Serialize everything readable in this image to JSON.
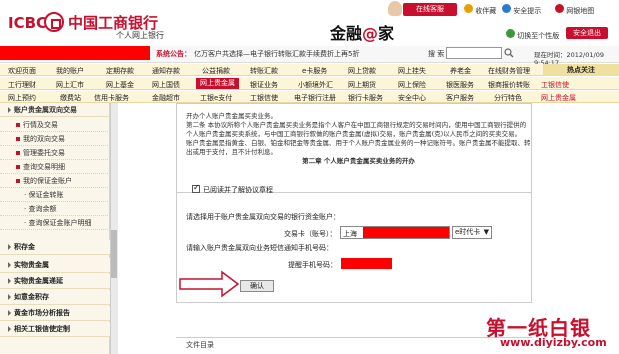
{
  "header": {
    "brand": "ICBC",
    "bank_name": "中国工商银行",
    "subtitle": "个人网上银行",
    "jinrong_a": "金融",
    "jinrong_at": "@",
    "jinrong_b": "家",
    "online_service": "在线客服",
    "favorites": "收伴藏",
    "security_notice": "安全提示",
    "site_nav": "网银地图",
    "switch_version": "切换至个性版",
    "safe_exit": "安全退出"
  },
  "notice": {
    "label": "系统公告：",
    "text": "亿万客户共选择—电子银行转账汇款手续费折上再5折",
    "search_label": "搜 索",
    "time": "现在时间：2012/01/09  9:54:17"
  },
  "nav": {
    "row1": [
      "欢迎页面",
      "我的账户",
      "定期存款",
      "通知存款",
      "公益捐款",
      "转账汇款",
      "e卡服务",
      "网上贷款",
      "网上挂失",
      "养老金",
      "在线财务管理"
    ],
    "row2": [
      "工行理财",
      "网上汇市",
      "网上基金",
      "网上国债",
      "网上贵金属",
      "银证业务",
      "小额境外汇",
      "网上期货",
      "网上保险",
      "银医服务",
      "银商报价转账"
    ],
    "row3": [
      "网上预约",
      "缴费站",
      "信用卡服务",
      "金融超市",
      "工银e支付",
      "工银信使",
      "电子银行注册",
      "银行卡服务",
      "安全中心",
      "客户服务",
      "分行特色"
    ],
    "active": "网上贵金属",
    "hot_title": "热点关注",
    "hot_items": [
      "工银信使",
      "网上贵金属"
    ]
  },
  "sidebar": {
    "head": "账户贵金属双向交易",
    "items": [
      "行情及交易",
      "我的双向交易",
      "管理委托交易",
      "查询交易明细",
      "我的保证金账户"
    ],
    "subitems": [
      "保证金转账",
      "查询余额",
      "查询保证金账户明细"
    ],
    "groups": [
      "积存金",
      "实物贵金属",
      "实物贵金属递延",
      "如意金积存",
      "黄金市场分析报告",
      "相关工银信使定制"
    ]
  },
  "main": {
    "agreement_line1": "开办个人账户贵金属买卖业务。",
    "agreement_line2": "第二条    本协议所称个人账户贵金属买卖业务是指个人客户在中国工商银行规定的交易时间内，使用中国工商银行提供的个人账户贵金属买卖系统，与中国工商银行叙做的账户贵金属(虚拟)交易，账户贵金属(克)以人民币之间的买卖交易。",
    "agreement_line3": "账户贵金属是指黄金、白银、铂金和钯金等贵金属、用于个人账户贵金属业务的一种记账符号。账户贵金属不能提取、转出或用于支付，且不计付利息。",
    "agreement_chapter": "第二章    个人账户贵金属买卖业务的开办",
    "agree_label": "已阅读并了解协议章程",
    "select_card_label": "请选择用于账户贵金属双向交易的银行资金账户：",
    "card_label": "交易卡（账号）：",
    "card_region": "上海",
    "card_type": "e时代卡",
    "phone_prompt": "请输入账户贵金属双向业务短信通知手机号码：",
    "phone_label": "提醒手机号码：",
    "confirm": "确认",
    "bottom": "文件目录"
  },
  "watermark": {
    "title": "第一纸白银",
    "url": "www.diyizby.com"
  }
}
